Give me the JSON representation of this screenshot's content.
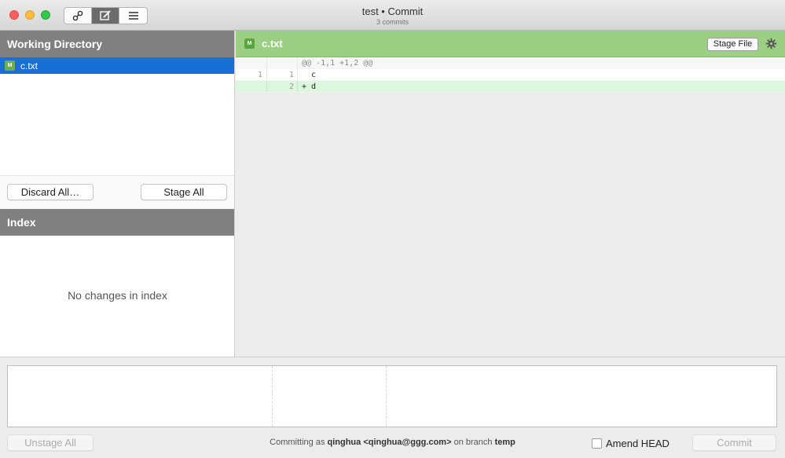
{
  "window": {
    "title": "test • Commit",
    "subtitle": "3 commits",
    "toolbar_icons": [
      "history-icon",
      "commit-edit-icon",
      "list-icon"
    ],
    "active_toolbar": "commit-edit-icon"
  },
  "working_directory": {
    "header": "Working Directory",
    "files": [
      {
        "status": "M",
        "name": "c.txt",
        "selected": true
      }
    ],
    "discard_label": "Discard All…",
    "stage_all_label": "Stage All"
  },
  "index": {
    "header": "Index",
    "empty_message": "No changes in index"
  },
  "diff": {
    "status": "M",
    "filename": "c.txt",
    "stage_file_label": "Stage File",
    "lines": [
      {
        "type": "hunk",
        "old": "",
        "new": "",
        "text": "@@ -1,1 +1,2 @@"
      },
      {
        "type": "context",
        "old": "1",
        "new": "1",
        "text": "  c"
      },
      {
        "type": "added",
        "old": "",
        "new": "2",
        "text": "+ d"
      }
    ]
  },
  "commit": {
    "unstage_all_label": "Unstage All",
    "committing_prefix": "Committing as",
    "author": "qinghua <qinghua@ggg.com>",
    "branch_prefix": "on branch",
    "branch": "temp",
    "amend_label": "Amend HEAD",
    "commit_label": "Commit"
  },
  "colors": {
    "selection": "#1a6fd6",
    "diff_header": "#9bcf83",
    "added_line": "#dcf8dc",
    "section_header": "#808080"
  }
}
